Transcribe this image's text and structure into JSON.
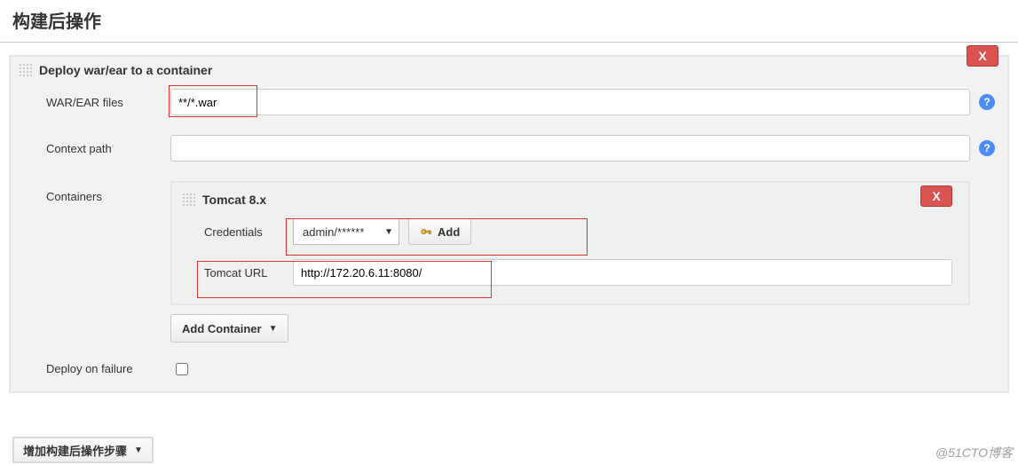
{
  "page": {
    "title": "构建后操作"
  },
  "section": {
    "title": "Deploy war/ear to a container",
    "close_label": "X",
    "fields": {
      "war_label": "WAR/EAR files",
      "war_value": "**/*.war",
      "context_label": "Context path",
      "context_value": "",
      "containers_label": "Containers",
      "deploy_on_failure_label": "Deploy on failure"
    },
    "container": {
      "title": "Tomcat 8.x",
      "close_label": "X",
      "credentials_label": "Credentials",
      "credentials_value": "admin/******",
      "add_button_label": "Add",
      "url_label": "Tomcat URL",
      "url_value": "http://172.20.6.11:8080/"
    },
    "add_container_label": "Add Container"
  },
  "footer": {
    "add_post_build_label": "增加构建后操作步骤"
  },
  "watermark": "@51CTO博客",
  "help_glyph": "?"
}
